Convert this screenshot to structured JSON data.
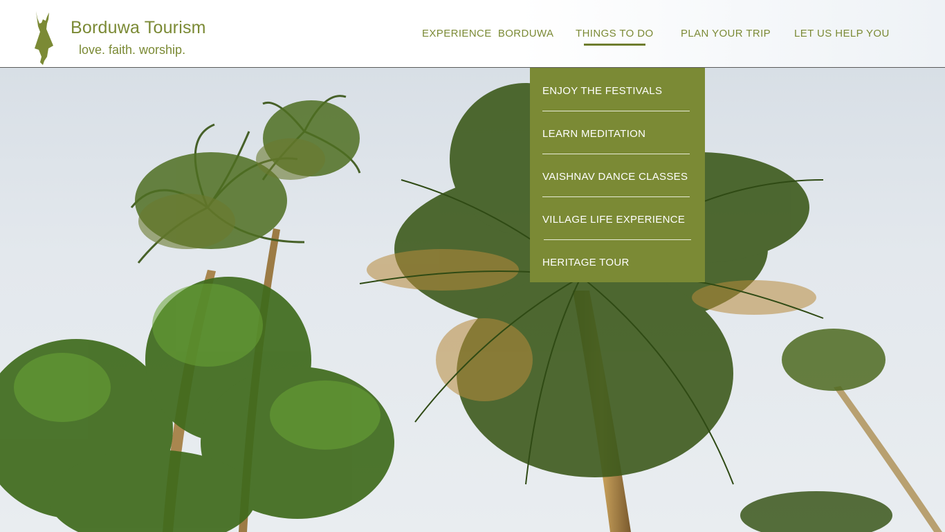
{
  "brand": {
    "title": "Borduwa Tourism",
    "tagline": "love. faith. worship.",
    "accent_color": "#7b8a35",
    "logo_icon": "dancer-silhouette-icon"
  },
  "nav": {
    "items": [
      {
        "label": "EXPERIENCE  BORDUWA"
      },
      {
        "label": "THINGS TO DO",
        "active": true
      },
      {
        "label": "PLAN YOUR TRIP"
      },
      {
        "label": "LET US HELP YOU"
      }
    ]
  },
  "dropdown": {
    "parent": "THINGS TO DO",
    "background_color": "#7b8a35",
    "items": [
      {
        "label": "ENJOY THE FESTIVALS"
      },
      {
        "label": "LEARN MEDITATION"
      },
      {
        "label": "VAISHNAV DANCE CLASSES"
      },
      {
        "label": "VILLAGE LIFE EXPERIENCE"
      },
      {
        "label": "HERITAGE TOUR"
      }
    ]
  },
  "hero": {
    "image": "palm-trees-sky-photo"
  }
}
